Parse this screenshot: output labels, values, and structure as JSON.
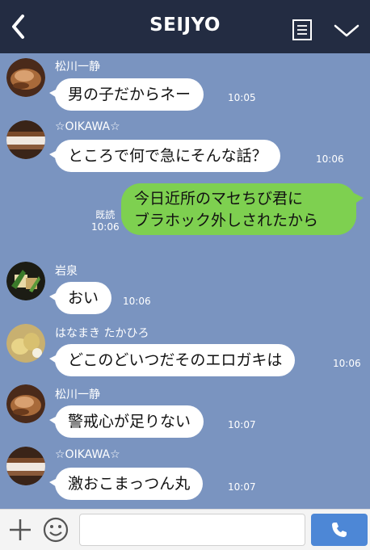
{
  "header": {
    "title": "SEIJYO",
    "back_icon": "chevron-left-icon",
    "note_icon": "note-icon",
    "menu_icon": "chevron-down-icon",
    "bg": "#232c42"
  },
  "chat_bg": "#7a94c0",
  "messages": [
    {
      "sender": "松川一静",
      "text": "男の子だからネー",
      "time": "10:05"
    },
    {
      "sender": "☆OIKAWA☆",
      "text": "ところで何で急にそんな話？",
      "time": "10:06"
    },
    {
      "own": true,
      "line1": "今日近所のマセちび君に",
      "line2": "ブラホック外しされたから",
      "read": "既読",
      "time": "10:06"
    },
    {
      "sender": "岩泉",
      "text": "おい",
      "time": "10:06"
    },
    {
      "sender": "はなまき たかひろ",
      "text": "どこのどいつだそのエロガキは",
      "time": "10:06"
    },
    {
      "sender": "松川一静",
      "text": "警戒心が足りない",
      "time": "10:07"
    },
    {
      "sender": "☆OIKAWA☆",
      "text": "激おこまっつん丸",
      "time": "10:07"
    }
  ],
  "footer": {
    "input_value": "",
    "plus_icon": "plus-icon",
    "emoji_icon": "smiley-icon",
    "send_icon": "phone-icon",
    "send_color": "#4d87d6"
  },
  "own_bubble_color": "#7ed050"
}
